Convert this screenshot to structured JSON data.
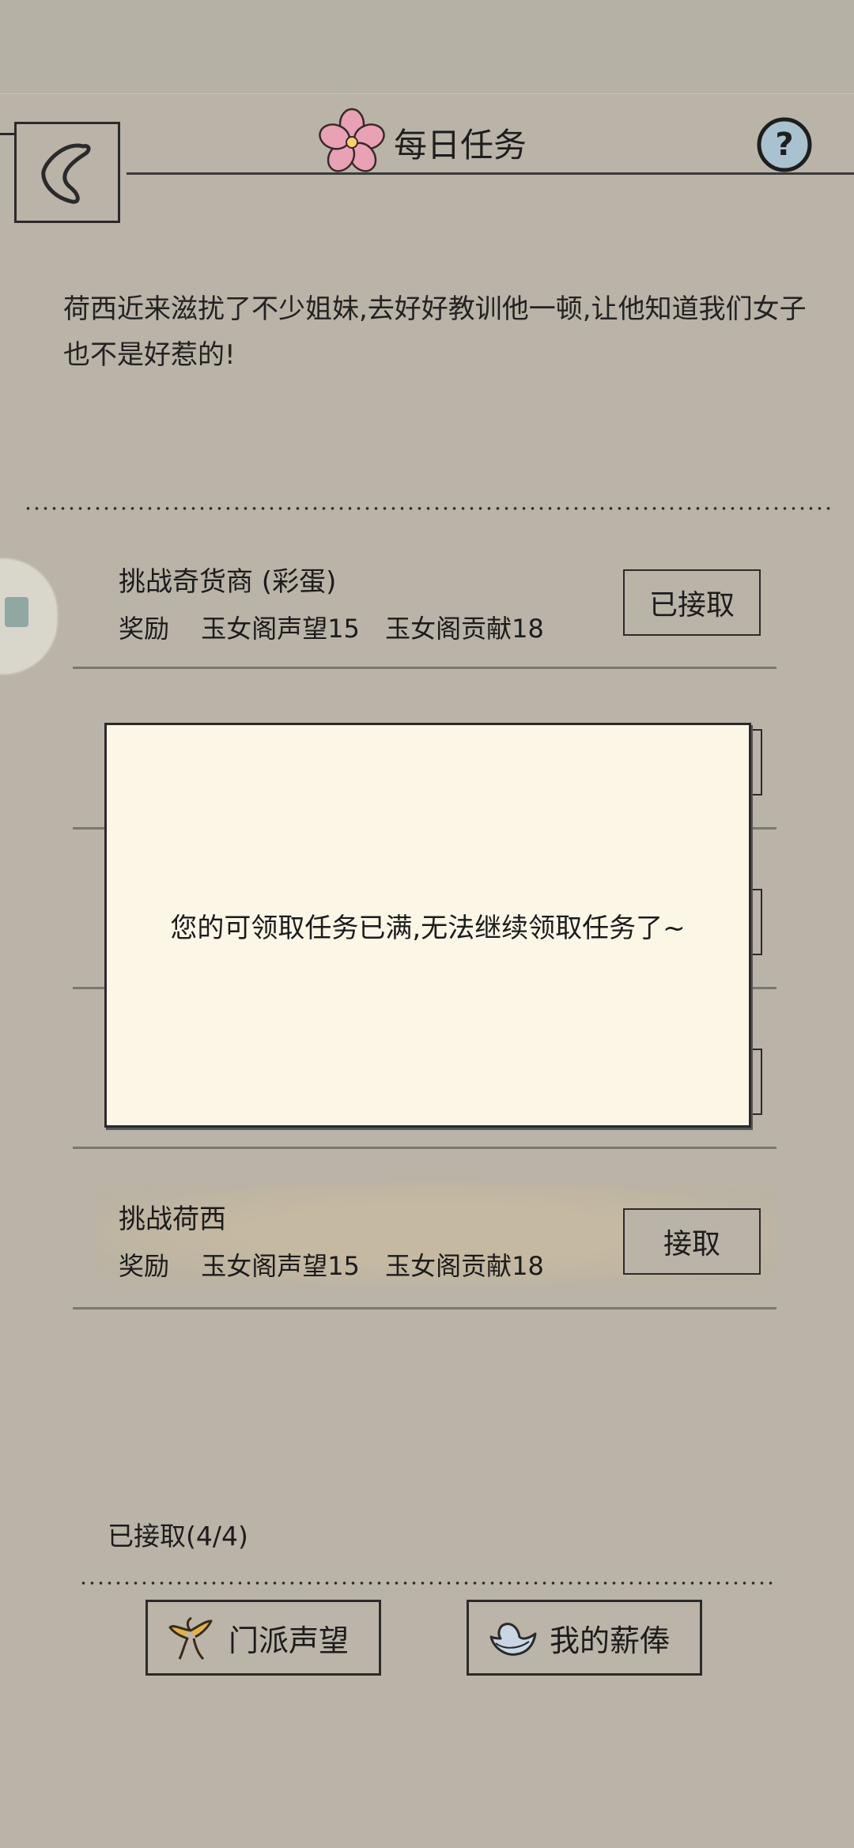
{
  "header": {
    "title": "每日任务"
  },
  "description": "荷西近来滋扰了不少姐妹,去好好教训他一顿,让他知道我们女子也不是好惹的!",
  "tasks": [
    {
      "title": "挑战奇货商 (彩蛋)",
      "reward_label": "奖励",
      "rewards": [
        "玉女阁声望15",
        "玉女阁贡献18"
      ],
      "button": "已接取"
    },
    {
      "title": "挑战荷西",
      "reward_label": "奖励",
      "rewards": [
        "玉女阁声望15",
        "玉女阁贡献18"
      ],
      "button": "接取"
    }
  ],
  "modal": {
    "message": "您的可领取任务已满,无法继续领取任务了~"
  },
  "footer": {
    "accepted_status": "已接取(4/4)",
    "buttons": [
      {
        "label": "门派声望",
        "icon": "bird-icon"
      },
      {
        "label": "我的薪俸",
        "icon": "ingot-icon"
      }
    ]
  }
}
